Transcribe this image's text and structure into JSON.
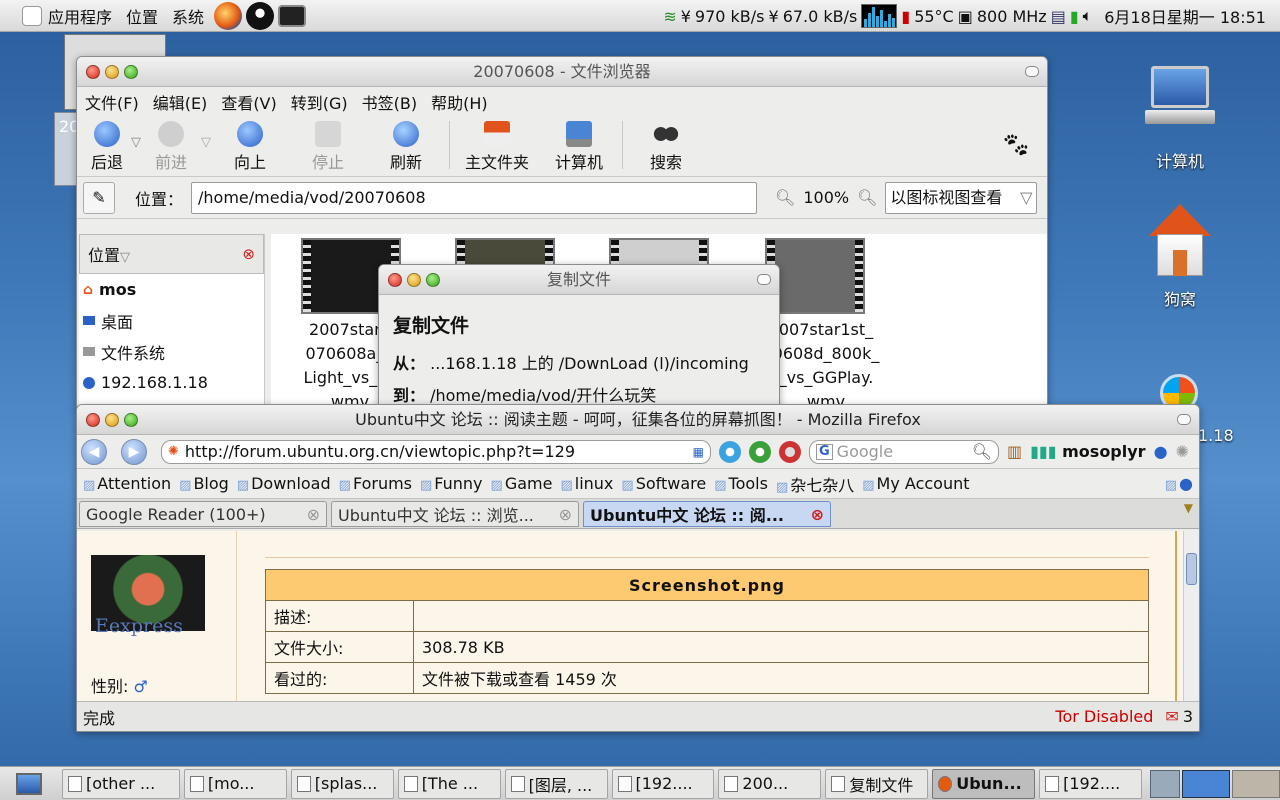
{
  "top_panel": {
    "menus": [
      "应用程序",
      "位置",
      "系统"
    ],
    "net_down": "970 kB/s",
    "net_up": "67.0 kB/s",
    "temp": "55°C",
    "cpu_freq": "800 MHz",
    "datetime": "6月18日星期一 18:51"
  },
  "nautilus": {
    "title": "20070608 - 文件浏览器",
    "menu": [
      "文件(F)",
      "编辑(E)",
      "查看(V)",
      "转到(G)",
      "书签(B)",
      "帮助(H)"
    ],
    "toolbar": {
      "back": "后退",
      "forward": "前进",
      "up": "向上",
      "stop": "停止",
      "reload": "刷新",
      "home": "主文件夹",
      "computer": "计算机",
      "search": "搜索"
    },
    "location_label": "位置：",
    "path": "/home/media/vod/20070608",
    "zoom": "100%",
    "view_mode": "以图标视图查看",
    "sidebar_header": "位置",
    "places": [
      "mos",
      "桌面",
      "文件系统",
      "192.168.1.18"
    ],
    "files": [
      {
        "l1": "2007star1",
        "l2": "070608a_8",
        "l3": "Light_vs_sA",
        "l4": "wmv"
      },
      {
        "l1": "007star1st_",
        "l2": "0608d_800k_",
        "l3": "_vs_GGPlay.",
        "l4": "wmv"
      }
    ]
  },
  "copy_dialog": {
    "title": "复制文件",
    "heading": "复制文件",
    "from_label": "从：",
    "from": "...168.1.18 上的 /DownLoad (l)/incoming",
    "to_label": "到：",
    "to": "/home/media/vod/开什么玩笑"
  },
  "firefox": {
    "title": "Ubuntu中文 论坛 :: 阅读主题 - 呵呵，征集各位的屏幕抓图！ - Mozilla Firefox",
    "url": "http://forum.ubuntu.org.cn/viewtopic.php?t=129",
    "search_placeholder": "Google",
    "user": "mosoplyr",
    "bookmarks": [
      "Attention",
      "Blog",
      "Download",
      "Forums",
      "Funny",
      "Game",
      "linux",
      "Software",
      "Tools",
      "杂七杂八",
      "My Account"
    ],
    "tabs": [
      "Google Reader (100+)",
      "Ubuntu中文 论坛 :: 浏览...",
      "Ubuntu中文 论坛 :: 阅..."
    ],
    "post": {
      "gender_label": "性别:",
      "avatar_text": "Eexpress",
      "attachment_title": "Screenshot.png",
      "rows": [
        {
          "k": "描述:",
          "v": ""
        },
        {
          "k": "文件大小:",
          "v": "308.78 KB"
        },
        {
          "k": "看过的:",
          "v": "文件被下载或查看 1459 次"
        }
      ]
    },
    "status": "完成",
    "tor": "Tor Disabled",
    "mail_count": "3"
  },
  "desktop": {
    "icons": [
      "计算机",
      "狗窝"
    ],
    "ip_fragment": "1.18",
    "left_fragment": "20"
  },
  "taskbar": [
    "[other ...",
    "[mo...",
    "[splas...",
    "[The ...",
    "[图层, ...",
    "[192....",
    "200...",
    "复制文件",
    "Ubun...",
    "[192...."
  ],
  "colors": {
    "accent": "#fdca72",
    "tor": "#cc0000"
  }
}
